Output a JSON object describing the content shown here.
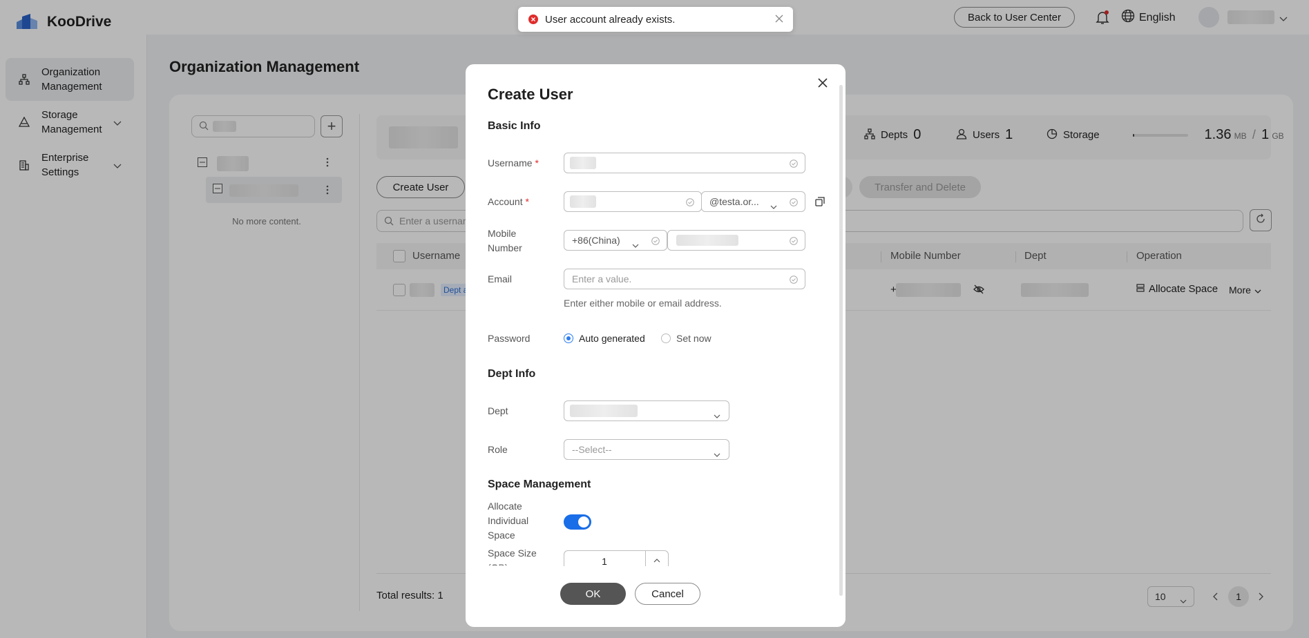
{
  "app": {
    "name": "KooDrive"
  },
  "sidebar": {
    "items": [
      {
        "label": "Organization Management"
      },
      {
        "label": "Storage Management"
      },
      {
        "label": "Enterprise Settings"
      }
    ]
  },
  "topbar": {
    "back_label": "Back to User Center",
    "language": "English"
  },
  "page": {
    "title": "Organization Management"
  },
  "tree": {
    "no_more": "No more content."
  },
  "stats": {
    "depts_label": "Depts",
    "depts_value": "0",
    "users_label": "Users",
    "users_value": "1",
    "storage_label": "Storage",
    "storage_used": "1.36",
    "storage_used_unit": "MB",
    "storage_sep": "/",
    "storage_total": "1",
    "storage_total_unit": "GB",
    "storage_fraction": 0.0013
  },
  "toolbar": {
    "create_user": "Create User",
    "transfer_delete": "Transfer and Delete",
    "search_placeholder": "Enter a usernam"
  },
  "table": {
    "columns": [
      "Username",
      "Mobile Number",
      "Dept",
      "Operation"
    ],
    "row": {
      "tag": "Dept a",
      "mobile_prefix": "+i",
      "allocate": "Allocate Space",
      "more": "More"
    }
  },
  "footer": {
    "total": "Total results: 1",
    "page_size": "10",
    "page": "1"
  },
  "toast": {
    "message": "User account already exists."
  },
  "modal": {
    "title": "Create User",
    "basic_info": "Basic Info",
    "username_label": "Username",
    "account_label": "Account",
    "account_domain": "@testa.or...",
    "mobile_label": "Mobile Number",
    "country_code": "+86(China)",
    "email_label": "Email",
    "email_placeholder": "Enter a value.",
    "hint": "Enter either mobile or email address.",
    "password_label": "Password",
    "pw_auto": "Auto generated",
    "pw_set": "Set now",
    "dept_info": "Dept Info",
    "dept_label": "Dept",
    "role_label": "Role",
    "role_placeholder": "--Select--",
    "space_mgmt": "Space Management",
    "allocate_label": "Allocate Individual Space",
    "space_size_label": "Space Size (GB)",
    "space_size_value": "1",
    "ok": "OK",
    "cancel": "Cancel"
  }
}
